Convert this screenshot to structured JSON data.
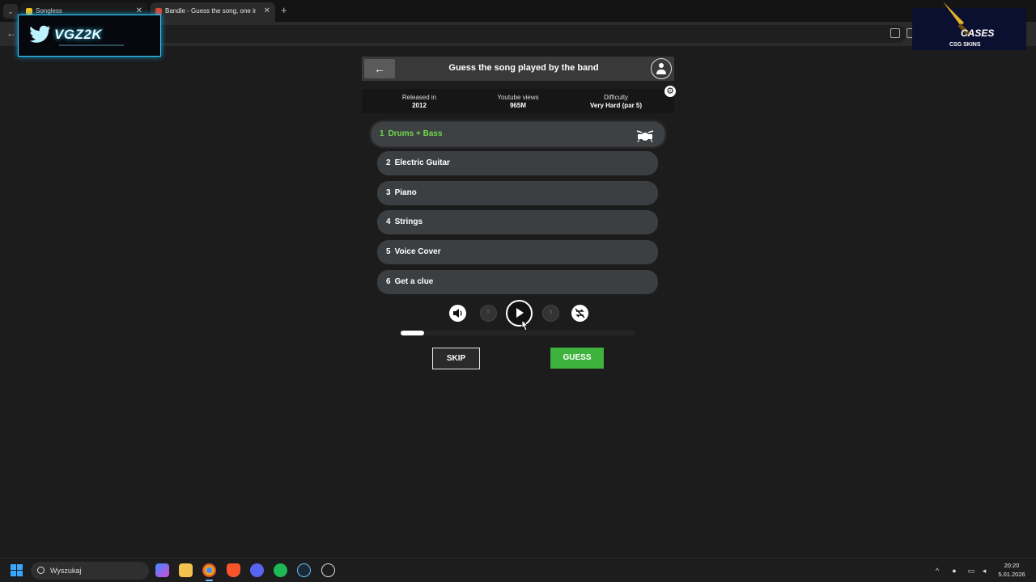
{
  "browser": {
    "tabs": [
      {
        "label": "Songless",
        "active": false,
        "favicon_color": "#f2c21b"
      },
      {
        "label": "Bandle - Guess the song, one instrument at a time",
        "active": true,
        "favicon_color": "#d8473a"
      }
    ],
    "new_tab_glyph": "+",
    "back_glyph": "←"
  },
  "overlays": {
    "vgz_text": "VGZ2K",
    "cases_text": "CASES",
    "cases_sub": "CSG SKINS"
  },
  "app": {
    "back_glyph": "←",
    "title": "Guess the song played by the band",
    "info": {
      "released_label": "Released in",
      "released_value": "2012",
      "views_label": "Youtube views",
      "views_value": "965M",
      "difficulty_label": "Difficulty",
      "difficulty_value": "Very Hard (par 5)"
    },
    "settings_glyph": "⚙",
    "stages": [
      {
        "num": "1",
        "label": "Drums + Bass",
        "active": true
      },
      {
        "num": "2",
        "label": "Electric Guitar",
        "active": false
      },
      {
        "num": "3",
        "label": "Piano",
        "active": false
      },
      {
        "num": "4",
        "label": "Strings",
        "active": false
      },
      {
        "num": "5",
        "label": "Voice Cover",
        "active": false
      },
      {
        "num": "6",
        "label": "Get a clue",
        "active": false
      }
    ],
    "player": {
      "rewind_label": "5",
      "forward_label": "5",
      "progress": 0.1
    },
    "skip_label": "SKIP",
    "guess_label": "GUESS",
    "accent_color": "#3db23c",
    "active_stage_color": "#6fd84b"
  },
  "taskbar": {
    "search_placeholder": "Wyszukaj",
    "time": "20:20",
    "date": "5.01.2026",
    "apps": [
      "copilot-icon",
      "file-explorer-icon",
      "chrome-icon",
      "brave-icon",
      "discord-icon",
      "spotify-icon",
      "steam-icon",
      "app-icon"
    ]
  }
}
